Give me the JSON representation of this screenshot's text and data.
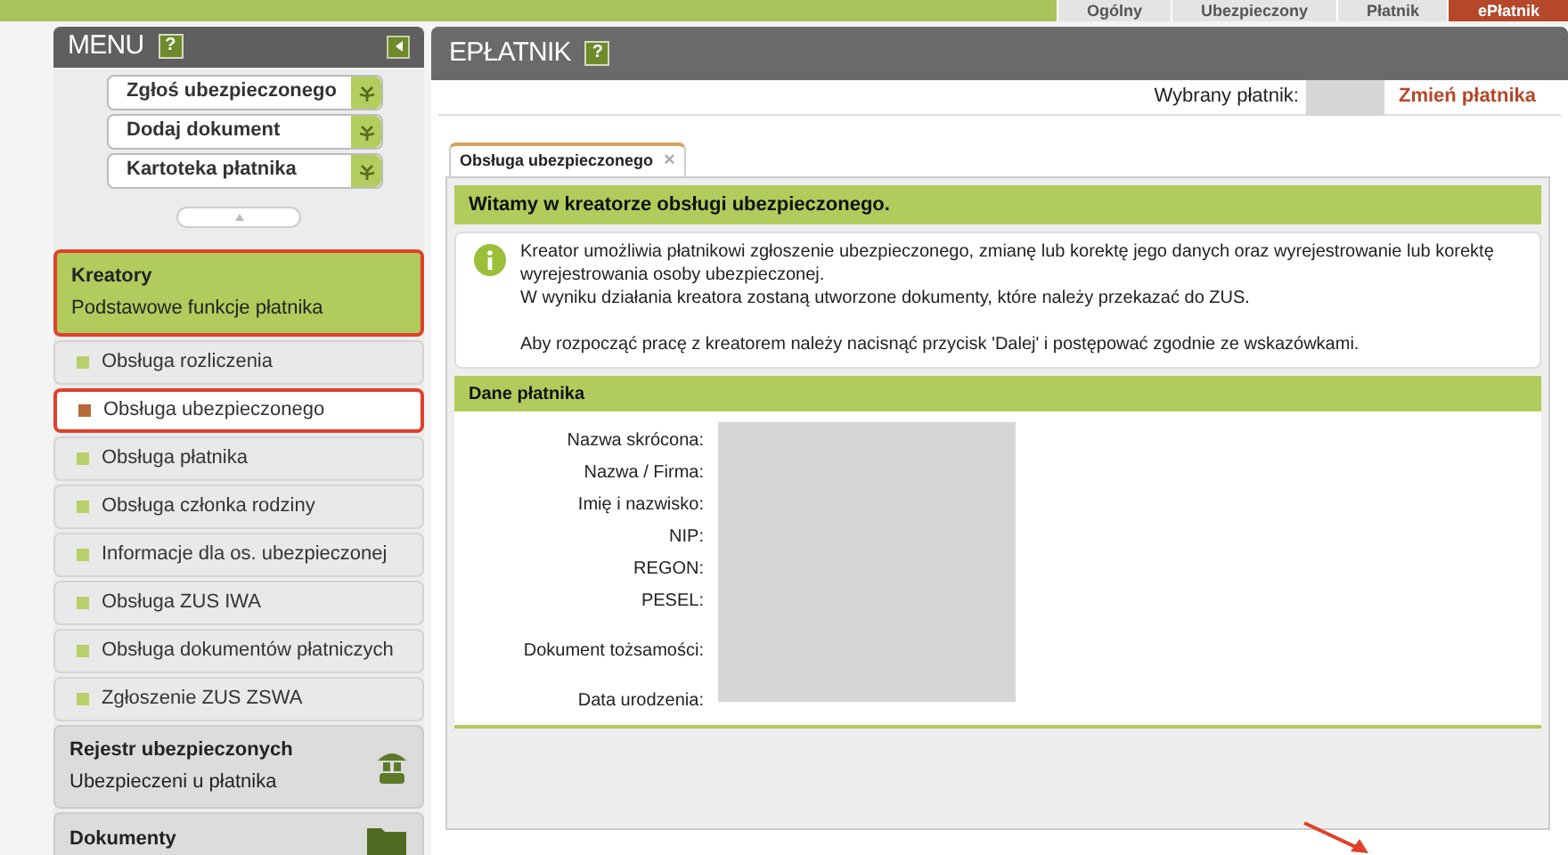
{
  "top_tabs": [
    {
      "label": "Ogólny",
      "selected": false
    },
    {
      "label": "Ubezpieczony",
      "selected": false
    },
    {
      "label": "Płatnik",
      "selected": false
    },
    {
      "label": "ePłatnik",
      "selected": true
    }
  ],
  "sidebar": {
    "title": "MENU",
    "help": "?",
    "quick_buttons": [
      "Zgłoś ubezpieczonego",
      "Dodaj dokument",
      "Kartoteka płatnika"
    ],
    "sections": [
      {
        "title": "Kreatory",
        "subtitle": "Podstawowe funkcje płatnika",
        "expanded": true,
        "highlighted": true,
        "items": [
          {
            "label": "Obsługa rozliczenia",
            "selected": false,
            "highlighted": false
          },
          {
            "label": "Obsługa ubezpieczonego",
            "selected": true,
            "highlighted": true
          },
          {
            "label": "Obsługa płatnika",
            "selected": false,
            "highlighted": false
          },
          {
            "label": "Obsługa członka rodziny",
            "selected": false,
            "highlighted": false
          },
          {
            "label": "Informacje dla os. ubezpieczonej",
            "selected": false,
            "highlighted": false
          },
          {
            "label": "Obsługa ZUS IWA",
            "selected": false,
            "highlighted": false
          },
          {
            "label": "Obsługa dokumentów płatniczych",
            "selected": false,
            "highlighted": false
          },
          {
            "label": "Zgłoszenie ZUS ZSWA",
            "selected": false,
            "highlighted": false
          }
        ]
      },
      {
        "title": "Rejestr ubezpieczonych",
        "subtitle": "Ubezpieczeni u płatnika",
        "expanded": false,
        "highlighted": false,
        "kind": "people"
      },
      {
        "title": "Dokumenty",
        "expanded": false,
        "highlighted": false,
        "kind": "folder"
      }
    ]
  },
  "main": {
    "title": "EPŁATNIK",
    "help": "?",
    "payer_label": "Wybrany płatnik:",
    "change_link": "Zmień płatnika",
    "doc_tab": {
      "label": "Obsługa ubezpieczonego",
      "close": "×"
    },
    "welcome": "Witamy w kreatorze obsługi ubezpieczonego.",
    "info_lines": [
      "Kreator umożliwia płatnikowi zgłoszenie ubezpieczonego, zmianę lub korektę jego danych oraz wyrejestrowanie lub korektę wyrejestrowania osoby ubezpieczonej.",
      "W wyniku działania kreatora zostaną utworzone dokumenty, które należy przekazać do ZUS.",
      "Aby rozpocząć pracę z kreatorem należy nacisnąć przycisk 'Dalej' i postępować zgodnie ze wskazówkami."
    ],
    "payer_section": {
      "title": "Dane płatnika",
      "fields": [
        "Nazwa skrócona:",
        "Nazwa / Firma:",
        "Imię i nazwisko:",
        "NIP:",
        "REGON:",
        "PESEL:",
        "Dokument tożsamości:",
        "Data urodzenia:"
      ]
    }
  }
}
